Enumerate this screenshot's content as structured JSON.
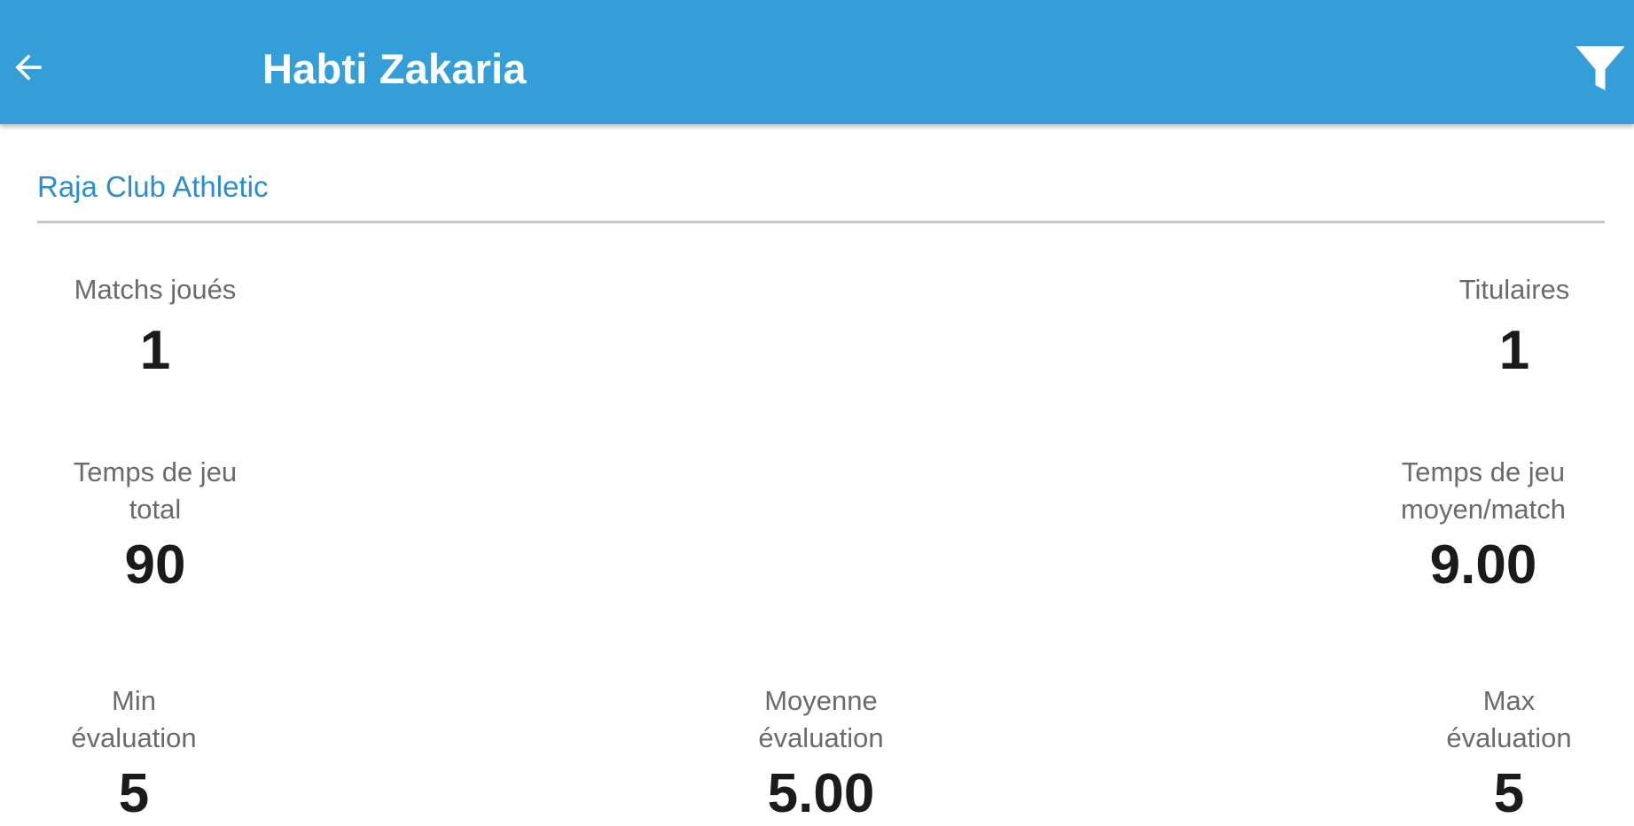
{
  "appbar": {
    "title": "Habti Zakaria",
    "back_icon": "arrow-left-icon",
    "filter_icon": "filter-icon",
    "color": "#349ed8"
  },
  "club": {
    "name": "Raja Club Athletic",
    "color": "#2a8fd0"
  },
  "stats": {
    "matches_played": {
      "label": "Matchs joués",
      "value": "1"
    },
    "starters": {
      "label": "Titulaires",
      "value": "1"
    },
    "total_playtime": {
      "label": "Temps de jeu\ntotal",
      "value": "90"
    },
    "avg_playtime": {
      "label": "Temps de jeu\nmoyen/match",
      "value": "9.00"
    },
    "min_rating": {
      "label": "Min\névaluation",
      "value": "5"
    },
    "avg_rating": {
      "label": "Moyenne\névaluation",
      "value": "5.00"
    },
    "max_rating": {
      "label": "Max\névaluation",
      "value": "5"
    }
  }
}
